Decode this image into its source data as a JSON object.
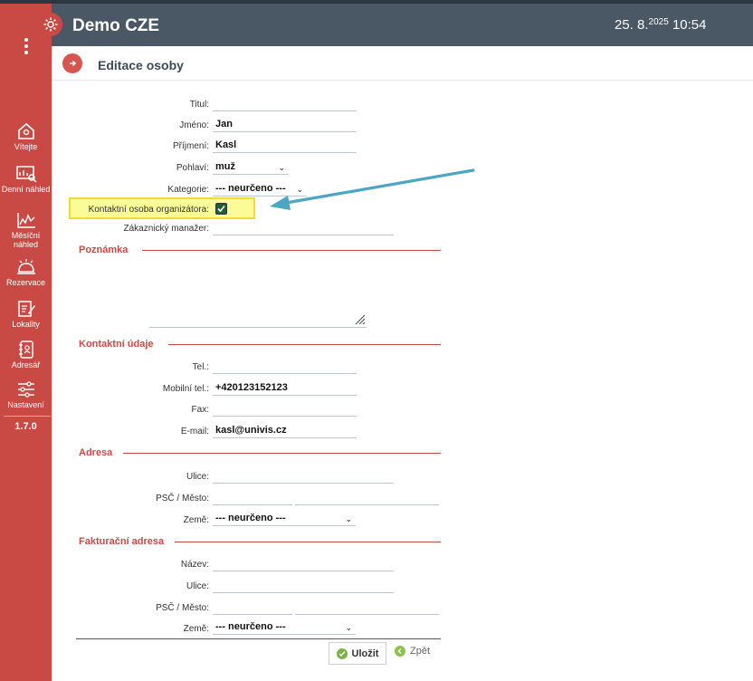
{
  "app": {
    "title": "Demo CZE",
    "date_main": "25. 8.",
    "date_year": "2025",
    "time": "10:54",
    "version": "1.7.0"
  },
  "sidebar": {
    "items": [
      {
        "label": "Vítejte",
        "icon": "home-icon"
      },
      {
        "label": "Denní náhled",
        "icon": "daily-chart-icon"
      },
      {
        "label": "Měsíční náhled",
        "icon": "monthly-chart-icon"
      },
      {
        "label": "Rezervace",
        "icon": "bell-icon"
      },
      {
        "label": "Lokality",
        "icon": "edit-note-icon"
      },
      {
        "label": "Adresář",
        "icon": "address-book-icon"
      },
      {
        "label": "Nastavení",
        "icon": "sliders-icon"
      }
    ]
  },
  "page": {
    "title": "Editace osoby"
  },
  "person": {
    "titul_label": "Titul:",
    "titul_value": "",
    "jmeno_label": "Jméno:",
    "jmeno_value": "Jan",
    "prijmeni_label": "Příjmení:",
    "prijmeni_value": "Kasl",
    "pohlavi_label": "Pohlaví:",
    "pohlavi_value": "muž",
    "kategorie_label": "Kategorie:",
    "kategorie_value": "--- neurčeno ---",
    "kontakt_label": "Kontaktní osoba organizátora:",
    "kontakt_checked": true,
    "manager_label": "Zákaznický manažer:",
    "manager_value": ""
  },
  "note": {
    "section": "Poznámka",
    "value": ""
  },
  "contact": {
    "section": "Kontaktní údaje",
    "tel_label": "Tel.:",
    "tel_value": "",
    "mobil_label": "Mobilní tel.:",
    "mobil_value": "+420123152123",
    "fax_label": "Fax:",
    "fax_value": "",
    "email_label": "E-mail:",
    "email_value": "kasl@univis.cz"
  },
  "address": {
    "section": "Adresa",
    "ulice_label": "Ulice:",
    "ulice_value": "",
    "psc_label": "PSČ / Město:",
    "psc_value": "",
    "mesto_value": "",
    "zeme_label": "Země:",
    "zeme_value": "--- neurčeno ---"
  },
  "billing": {
    "section": "Fakturační adresa",
    "nazev_label": "Název:",
    "nazev_value": "",
    "ulice_label": "Ulice:",
    "ulice_value": "",
    "psc_label": "PSČ / Město:",
    "psc_value": "",
    "mesto_value": "",
    "zeme_label": "Země:",
    "zeme_value": "--- neurčeno ---"
  },
  "actions": {
    "save_label": "Uložit",
    "back_label": "Zpět"
  },
  "colors": {
    "sidebar": "#c94a45",
    "header": "#4a5764",
    "section": "#c94a45",
    "highlight": "#fbfb98",
    "arrow": "#4aa6c2"
  }
}
